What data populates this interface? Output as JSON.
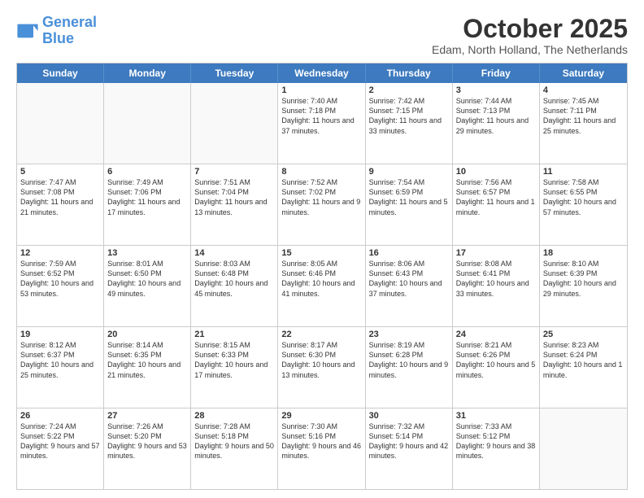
{
  "header": {
    "logo_line1": "General",
    "logo_line2": "Blue",
    "title": "October 2025",
    "subtitle": "Edam, North Holland, The Netherlands"
  },
  "days_of_week": [
    "Sunday",
    "Monday",
    "Tuesday",
    "Wednesday",
    "Thursday",
    "Friday",
    "Saturday"
  ],
  "weeks": [
    [
      {
        "day": "",
        "text": "",
        "empty": true
      },
      {
        "day": "",
        "text": "",
        "empty": true
      },
      {
        "day": "",
        "text": "",
        "empty": true
      },
      {
        "day": "1",
        "text": "Sunrise: 7:40 AM\nSunset: 7:18 PM\nDaylight: 11 hours and 37 minutes."
      },
      {
        "day": "2",
        "text": "Sunrise: 7:42 AM\nSunset: 7:15 PM\nDaylight: 11 hours and 33 minutes."
      },
      {
        "day": "3",
        "text": "Sunrise: 7:44 AM\nSunset: 7:13 PM\nDaylight: 11 hours and 29 minutes."
      },
      {
        "day": "4",
        "text": "Sunrise: 7:45 AM\nSunset: 7:11 PM\nDaylight: 11 hours and 25 minutes."
      }
    ],
    [
      {
        "day": "5",
        "text": "Sunrise: 7:47 AM\nSunset: 7:08 PM\nDaylight: 11 hours and 21 minutes."
      },
      {
        "day": "6",
        "text": "Sunrise: 7:49 AM\nSunset: 7:06 PM\nDaylight: 11 hours and 17 minutes."
      },
      {
        "day": "7",
        "text": "Sunrise: 7:51 AM\nSunset: 7:04 PM\nDaylight: 11 hours and 13 minutes."
      },
      {
        "day": "8",
        "text": "Sunrise: 7:52 AM\nSunset: 7:02 PM\nDaylight: 11 hours and 9 minutes."
      },
      {
        "day": "9",
        "text": "Sunrise: 7:54 AM\nSunset: 6:59 PM\nDaylight: 11 hours and 5 minutes."
      },
      {
        "day": "10",
        "text": "Sunrise: 7:56 AM\nSunset: 6:57 PM\nDaylight: 11 hours and 1 minute."
      },
      {
        "day": "11",
        "text": "Sunrise: 7:58 AM\nSunset: 6:55 PM\nDaylight: 10 hours and 57 minutes."
      }
    ],
    [
      {
        "day": "12",
        "text": "Sunrise: 7:59 AM\nSunset: 6:52 PM\nDaylight: 10 hours and 53 minutes."
      },
      {
        "day": "13",
        "text": "Sunrise: 8:01 AM\nSunset: 6:50 PM\nDaylight: 10 hours and 49 minutes."
      },
      {
        "day": "14",
        "text": "Sunrise: 8:03 AM\nSunset: 6:48 PM\nDaylight: 10 hours and 45 minutes."
      },
      {
        "day": "15",
        "text": "Sunrise: 8:05 AM\nSunset: 6:46 PM\nDaylight: 10 hours and 41 minutes."
      },
      {
        "day": "16",
        "text": "Sunrise: 8:06 AM\nSunset: 6:43 PM\nDaylight: 10 hours and 37 minutes."
      },
      {
        "day": "17",
        "text": "Sunrise: 8:08 AM\nSunset: 6:41 PM\nDaylight: 10 hours and 33 minutes."
      },
      {
        "day": "18",
        "text": "Sunrise: 8:10 AM\nSunset: 6:39 PM\nDaylight: 10 hours and 29 minutes."
      }
    ],
    [
      {
        "day": "19",
        "text": "Sunrise: 8:12 AM\nSunset: 6:37 PM\nDaylight: 10 hours and 25 minutes."
      },
      {
        "day": "20",
        "text": "Sunrise: 8:14 AM\nSunset: 6:35 PM\nDaylight: 10 hours and 21 minutes."
      },
      {
        "day": "21",
        "text": "Sunrise: 8:15 AM\nSunset: 6:33 PM\nDaylight: 10 hours and 17 minutes."
      },
      {
        "day": "22",
        "text": "Sunrise: 8:17 AM\nSunset: 6:30 PM\nDaylight: 10 hours and 13 minutes."
      },
      {
        "day": "23",
        "text": "Sunrise: 8:19 AM\nSunset: 6:28 PM\nDaylight: 10 hours and 9 minutes."
      },
      {
        "day": "24",
        "text": "Sunrise: 8:21 AM\nSunset: 6:26 PM\nDaylight: 10 hours and 5 minutes."
      },
      {
        "day": "25",
        "text": "Sunrise: 8:23 AM\nSunset: 6:24 PM\nDaylight: 10 hours and 1 minute."
      }
    ],
    [
      {
        "day": "26",
        "text": "Sunrise: 7:24 AM\nSunset: 5:22 PM\nDaylight: 9 hours and 57 minutes."
      },
      {
        "day": "27",
        "text": "Sunrise: 7:26 AM\nSunset: 5:20 PM\nDaylight: 9 hours and 53 minutes."
      },
      {
        "day": "28",
        "text": "Sunrise: 7:28 AM\nSunset: 5:18 PM\nDaylight: 9 hours and 50 minutes."
      },
      {
        "day": "29",
        "text": "Sunrise: 7:30 AM\nSunset: 5:16 PM\nDaylight: 9 hours and 46 minutes."
      },
      {
        "day": "30",
        "text": "Sunrise: 7:32 AM\nSunset: 5:14 PM\nDaylight: 9 hours and 42 minutes."
      },
      {
        "day": "31",
        "text": "Sunrise: 7:33 AM\nSunset: 5:12 PM\nDaylight: 9 hours and 38 minutes."
      },
      {
        "day": "",
        "text": "",
        "empty": true
      }
    ]
  ]
}
